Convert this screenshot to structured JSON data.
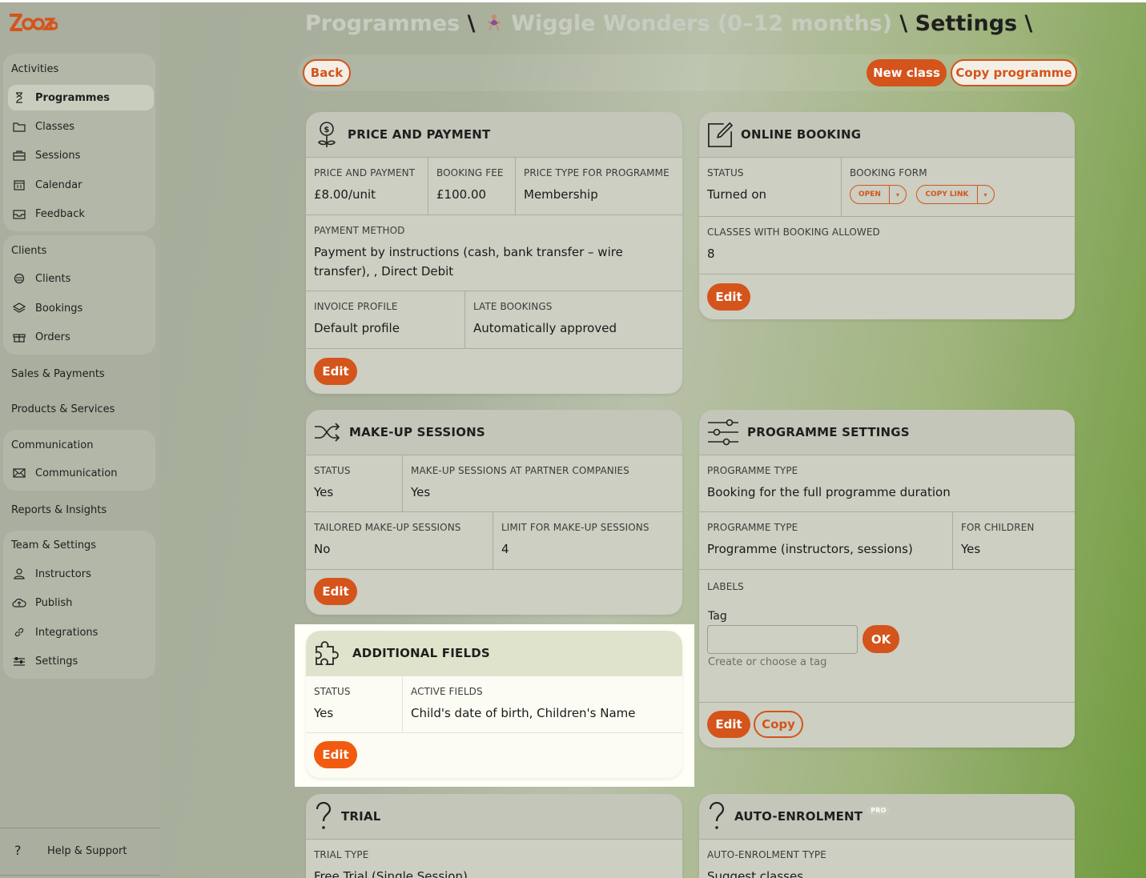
{
  "app": {
    "logo_text": "Zooza"
  },
  "colors": {
    "accent": "#d4541b",
    "accent_highlight": "#f25a10",
    "sidebar_bg": "#a9ae9e"
  },
  "sidebar": {
    "activities": {
      "title": "Activities",
      "items": [
        {
          "label": "Programmes",
          "icon": "hourglass-icon",
          "active": true
        },
        {
          "label": "Classes",
          "icon": "folder-icon"
        },
        {
          "label": "Sessions",
          "icon": "briefcase-icon"
        },
        {
          "label": "Calendar",
          "icon": "calendar-icon"
        },
        {
          "label": "Feedback",
          "icon": "inbox-icon"
        }
      ]
    },
    "clients": {
      "title": "Clients",
      "items": [
        {
          "label": "Clients",
          "icon": "users-icon"
        },
        {
          "label": "Bookings",
          "icon": "layers-icon"
        },
        {
          "label": "Orders",
          "icon": "gift-icon"
        }
      ]
    },
    "sales": "Sales & Payments",
    "products": "Products & Services",
    "communication": {
      "title": "Communication",
      "items": [
        {
          "label": "Communication",
          "icon": "mail-icon"
        }
      ]
    },
    "reports": "Reports & Insights",
    "team": {
      "title": "Team & Settings",
      "items": [
        {
          "label": "Instructors",
          "icon": "person-icon"
        },
        {
          "label": "Publish",
          "icon": "cloud-icon"
        },
        {
          "label": "Integrations",
          "icon": "link-icon"
        },
        {
          "label": "Settings",
          "icon": "settings-icon"
        }
      ]
    },
    "help": "Help & Support"
  },
  "breadcrumb": {
    "part1": "Programmes",
    "sep": "\\",
    "part2": "Wiggle Wonders (0–12 months)",
    "part3": "Settings"
  },
  "toolbar": {
    "back": "Back",
    "new_class": "New class",
    "copy_programme": "Copy programme"
  },
  "price": {
    "title": "PRICE AND PAYMENT",
    "price_label": "PRICE AND PAYMENT",
    "price_value": "£8.00/unit",
    "fee_label": "BOOKING FEE",
    "fee_value": "£100.00",
    "type_label": "PRICE TYPE FOR PROGRAMME",
    "type_value": "Membership",
    "method_label": "PAYMENT METHOD",
    "method_value": "Payment by instructions (cash, bank transfer – wire transfer), , Direct Debit",
    "invoice_label": "INVOICE PROFILE",
    "invoice_value": "Default profile",
    "late_label": "LATE BOOKINGS",
    "late_value": "Automatically approved",
    "edit": "Edit"
  },
  "online": {
    "title": "ONLINE BOOKING",
    "status_label": "STATUS",
    "status_value": "Turned on",
    "form_label": "BOOKING FORM",
    "open": "OPEN",
    "copy_link": "COPY LINK",
    "classes_label": "CLASSES WITH BOOKING ALLOWED",
    "classes_value": "8",
    "edit": "Edit"
  },
  "makeup": {
    "title": "MAKE-UP SESSIONS",
    "status_label": "STATUS",
    "status_value": "Yes",
    "partner_label": "MAKE-UP SESSIONS AT PARTNER COMPANIES",
    "partner_value": "Yes",
    "tailored_label": "TAILORED MAKE-UP SESSIONS",
    "tailored_value": "No",
    "limit_label": "LIMIT FOR MAKE-UP SESSIONS",
    "limit_value": "4",
    "edit": "Edit"
  },
  "programme": {
    "title": "PROGRAMME SETTINGS",
    "type_label": "PROGRAMME TYPE",
    "type_value": "Booking for the full programme duration",
    "type2_label": "PROGRAMME TYPE",
    "type2_value": "Programme (instructors, sessions)",
    "children_label": "FOR CHILDREN",
    "children_value": "Yes",
    "labels_label": "LABELS",
    "tag_label": "Tag",
    "ok": "OK",
    "tag_hint": "Create or choose a tag",
    "edit": "Edit",
    "copy": "Copy"
  },
  "additional": {
    "title": "ADDITIONAL FIELDS",
    "status_label": "STATUS",
    "status_value": "Yes",
    "active_label": "ACTIVE FIELDS",
    "active_value": "Child's date of birth, Children's Name",
    "edit": "Edit"
  },
  "trial": {
    "title": "TRIAL",
    "type_label": "TRIAL TYPE",
    "type_value": "Free Trial (Single Session)"
  },
  "auto": {
    "title": "AUTO-ENROLMENT",
    "badge": "PRO",
    "type_label": "AUTO-ENROLMENT TYPE",
    "type_value": "Suggest classes"
  }
}
